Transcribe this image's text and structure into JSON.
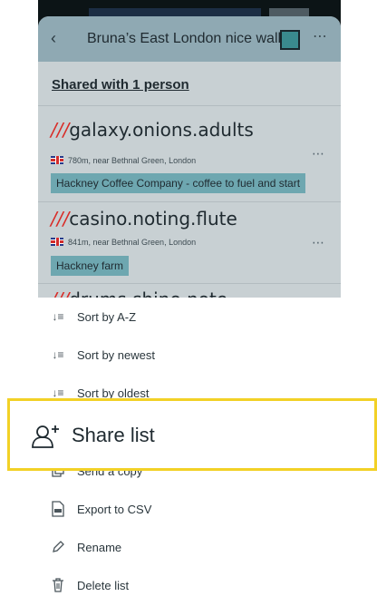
{
  "list_header": {
    "title": "Bruna’s East London nice walks",
    "swatch_color": "#3a8a8e"
  },
  "shared_with": "Shared with 1 person",
  "locations": [
    {
      "prefix": "///",
      "address": "galaxy.onions.adults",
      "distance": "780m, near Bethnal Green, London",
      "label": "Hackney Coffee Company - coffee to fuel and start"
    },
    {
      "prefix": "///",
      "address": "casino.noting.flute",
      "distance": "841m, near Bethnal Green, London",
      "label": "Hackney farm"
    },
    {
      "prefix": "///",
      "address": "drums.shine.note"
    }
  ],
  "menu": {
    "sort_az": "Sort by A-Z",
    "sort_newest": "Sort by newest",
    "sort_oldest": "Sort by oldest",
    "share_list": "Share list",
    "send_copy": "Send a copy",
    "export_csv": "Export to CSV",
    "rename": "Rename",
    "delete_list": "Delete list"
  },
  "colors": {
    "highlight_border": "#f2d126",
    "address_prefix": "#d92b27",
    "tag_background": "#6ea7b0"
  }
}
